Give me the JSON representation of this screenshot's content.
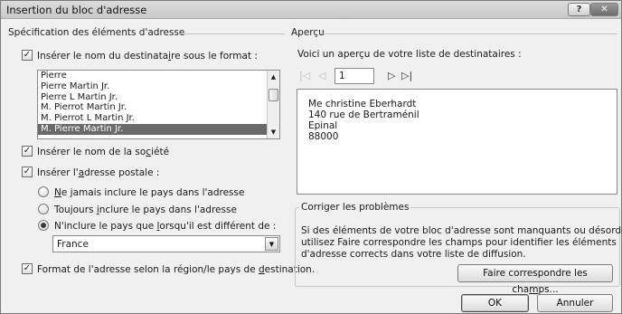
{
  "window": {
    "title": "Insertion du bloc d'adresse",
    "help_label": "?",
    "close_label": "✕"
  },
  "left": {
    "section_title": "Spécification des éléments d'adresse",
    "insert_name": {
      "checked": true,
      "label_a": "Insérer le nom du destinata",
      "label_u": "i",
      "label_b": "re sous le format :"
    },
    "name_formats": [
      "Pierre",
      "Pierre Martin Jr.",
      "Pierre L Martin Jr.",
      "M. Pierrot Martin Jr.",
      "M. Pierrot L Martin Jr.",
      "M. Pierre Martin Jr."
    ],
    "selected_format": "M. Pierre Martin Jr.",
    "insert_company": {
      "checked": true,
      "label_a": "Insérer le nom de la so",
      "label_u": "c",
      "label_b": "iété"
    },
    "insert_address": {
      "checked": true,
      "label_a": "Insérer l'",
      "label_u": "a",
      "label_b": "dresse postale :"
    },
    "country_options": [
      {
        "pre": "",
        "u": "N",
        "post": "e jamais inclure le pays dans l'adresse",
        "selected": false
      },
      {
        "pre": "Toujours ",
        "u": "i",
        "post": "nclure le pays dans l'adresse",
        "selected": false
      },
      {
        "pre": "N'inclure le pays que ",
        "u": "l",
        "post": "orsqu'il est différent de :",
        "selected": true
      }
    ],
    "country_value": "France",
    "format_by_region": {
      "checked": true,
      "label_a": "Format de l'adresse selon la région/le pays de ",
      "label_u": "d",
      "label_b": "estination."
    }
  },
  "right": {
    "section_title": "Aperçu",
    "preview_hint": "Voici un aperçu de votre liste de destinataires :",
    "record_number": "1",
    "preview_lines": [
      "Me christine Eberhardt",
      "140 rue de Bertraménil",
      "Epinal",
      "88000"
    ],
    "problems": {
      "title": "Corriger les problèmes",
      "lines": [
        "Si des éléments de votre bloc d'adresse sont manquants ou désordonnés,",
        "utilisez Faire correspondre les champs pour identifier les éléments",
        "d'adresse corrects dans votre liste de diffusion."
      ],
      "match_label_a": "Faire correspondre les cha",
      "match_label_u": "m",
      "match_label_b": "ps..."
    }
  },
  "footer": {
    "ok_label": "OK",
    "cancel_label": "Annuler"
  }
}
